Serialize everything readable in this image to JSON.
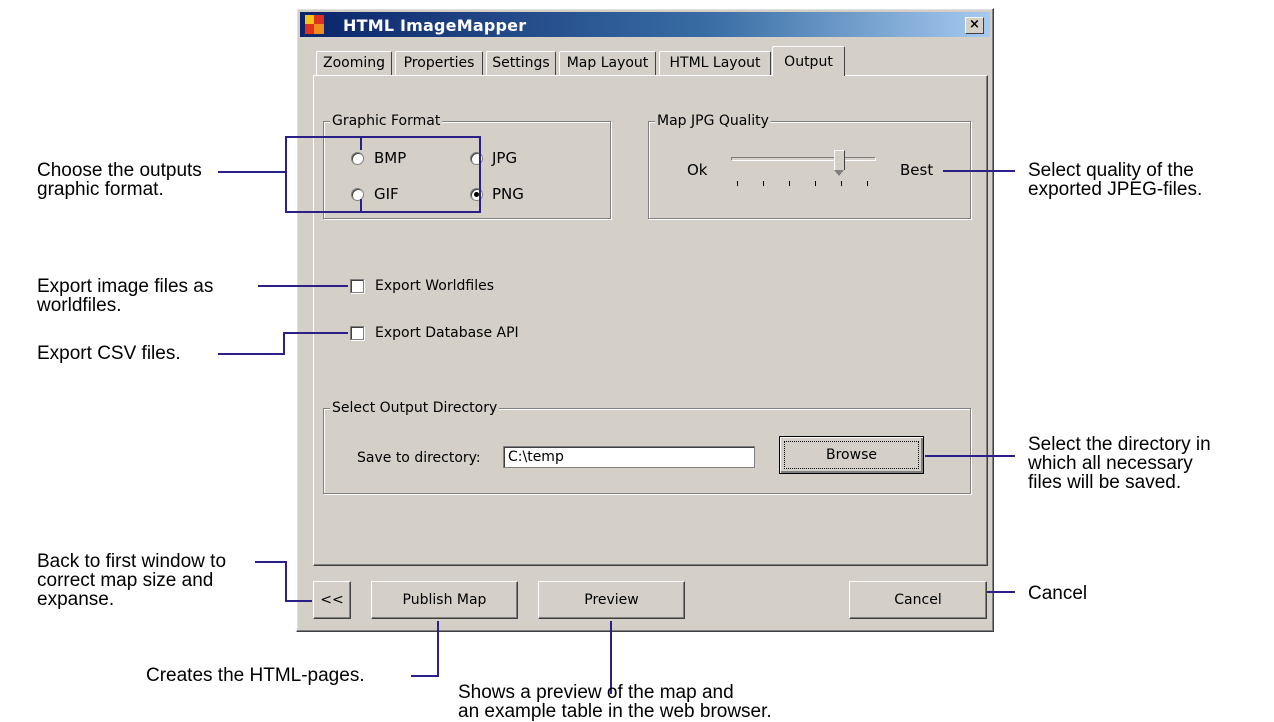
{
  "window": {
    "title": "HTML ImageMapper",
    "close_glyph": "×"
  },
  "tabs": [
    {
      "label": "Zooming",
      "active": false
    },
    {
      "label": "Properties",
      "active": false
    },
    {
      "label": "Settings",
      "active": false
    },
    {
      "label": "Map Layout",
      "active": false
    },
    {
      "label": "HTML Layout",
      "active": false
    },
    {
      "label": "Output",
      "active": true
    }
  ],
  "graphic_format": {
    "label": "Graphic Format",
    "options": [
      {
        "label": "BMP",
        "checked": false
      },
      {
        "label": "JPG",
        "checked": false
      },
      {
        "label": "GIF",
        "checked": false
      },
      {
        "label": "PNG",
        "checked": true
      }
    ]
  },
  "jpg_quality": {
    "label": "Map JPG Quality",
    "min_label": "Ok",
    "max_label": "Best",
    "level": 0.8
  },
  "checkboxes": {
    "worldfiles": {
      "label": "Export Worldfiles",
      "checked": false
    },
    "database_api": {
      "label": "Export Database API",
      "checked": false
    }
  },
  "output_directory": {
    "label": "Select Output Directory",
    "save_label": "Save to directory:",
    "value": "C:\\temp",
    "browse_label": "Browse"
  },
  "buttons": {
    "back": "<<",
    "publish": "Publish Map",
    "preview": "Preview",
    "cancel": "Cancel"
  },
  "annotations": {
    "graphic_format": [
      "Choose the outputs",
      "graphic format."
    ],
    "worldfiles": [
      "Export image files as",
      "worldfiles."
    ],
    "csv": [
      "Export CSV files."
    ],
    "quality": [
      "Select quality of the",
      "exported JPEG-files."
    ],
    "directory": [
      "Select the directory in",
      "which all necessary",
      "files will be saved."
    ],
    "back": [
      "Back to first window to",
      "correct map size and",
      "expanse."
    ],
    "cancel": [
      "Cancel"
    ],
    "publish": [
      "Creates the HTML-pages."
    ],
    "preview": [
      "Shows a preview of the map and",
      "an example table in the web browser."
    ]
  },
  "colors": {
    "dialog_face": "#d4d0c8",
    "title_gradient_start": "#0a246a",
    "callout_line": "#2b1f8a"
  }
}
